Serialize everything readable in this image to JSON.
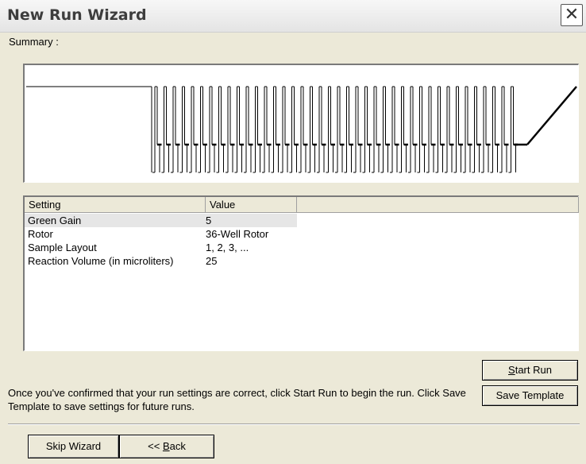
{
  "window": {
    "title": "New Run Wizard",
    "close_glyph": "✕"
  },
  "summary": {
    "label": "Summary :"
  },
  "table": {
    "columns": [
      "Setting",
      "Value"
    ],
    "rows": [
      {
        "setting": "Green Gain",
        "value": "5",
        "selected": true
      },
      {
        "setting": "Rotor",
        "value": "36-Well Rotor",
        "selected": false
      },
      {
        "setting": "Sample Layout",
        "value": "1, 2, 3, ...",
        "selected": false
      },
      {
        "setting": "Reaction Volume (in microliters)",
        "value": "25",
        "selected": false
      }
    ]
  },
  "buttons": {
    "start_run": {
      "label": "Start Run",
      "mnemonic": "S",
      "rest": "tart Run"
    },
    "save_template": {
      "label": "Save Template"
    },
    "skip_wizard": {
      "label": "Skip Wizard"
    },
    "back": {
      "label": "<< Back",
      "prefix": "<< ",
      "mnemonic": "B",
      "rest": "ack"
    }
  },
  "hint": {
    "text": "Once you've confirmed that your run settings are correct, click Start Run to begin the run. Click Save Template to save settings for future runs."
  },
  "profile": {
    "cycles": 40,
    "hold_level": "high",
    "cycle_levels": [
      "high",
      "mid",
      "low"
    ],
    "ends_with": "melt ramp"
  }
}
